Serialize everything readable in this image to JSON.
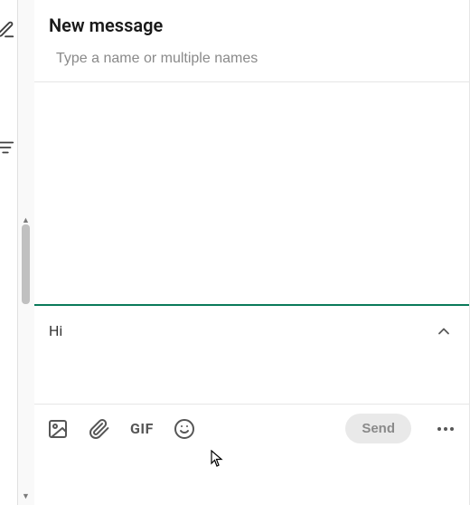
{
  "header": {
    "title": "New message"
  },
  "recipient": {
    "placeholder": "Type a name or multiple names",
    "value": ""
  },
  "compose": {
    "value": "Hi"
  },
  "toolbar": {
    "gif_label": "GIF",
    "send_label": "Send"
  },
  "icons": {
    "edit": "edit-icon",
    "list": "list-icon",
    "image": "image-icon",
    "attach": "paperclip-icon",
    "emoji": "smiley-icon",
    "expand": "chevron-up-icon",
    "more": "more-horizontal-icon"
  },
  "colors": {
    "accent": "#0a7a5a",
    "text_primary": "#191919",
    "text_muted": "#8a8a8a",
    "icon": "#565656",
    "send_bg": "#e9e9e9"
  }
}
